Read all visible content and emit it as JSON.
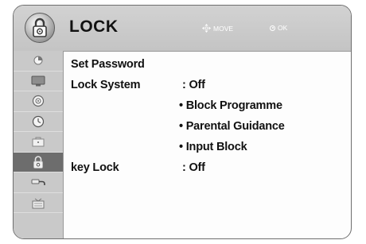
{
  "header": {
    "title": "LOCK",
    "icon": "lock-icon",
    "move_hint": "MOVE",
    "ok_hint": "OK"
  },
  "sidebar": {
    "items": [
      {
        "icon": "picture-icon",
        "selected": false
      },
      {
        "icon": "screen-icon",
        "selected": false
      },
      {
        "icon": "audio-icon",
        "selected": false
      },
      {
        "icon": "clock-icon",
        "selected": false
      },
      {
        "icon": "options-icon",
        "selected": false
      },
      {
        "icon": "lock-icon",
        "selected": true
      },
      {
        "icon": "input-icon",
        "selected": false
      },
      {
        "icon": "channel-icon",
        "selected": false
      }
    ]
  },
  "menu": {
    "set_password": "Set Password",
    "lock_system": {
      "label": "Lock System",
      "value": ": Off"
    },
    "sub_items": [
      "• Block Programme",
      "• Parental Guidance",
      "• Input Block"
    ],
    "key_lock": {
      "label": "key Lock",
      "value": ": Off"
    }
  },
  "colors": {
    "header_bg": "#c8c8c8",
    "sidebar_bg": "#c9c9c9",
    "selected_bg": "#6d6d6d",
    "text": "#111111"
  }
}
